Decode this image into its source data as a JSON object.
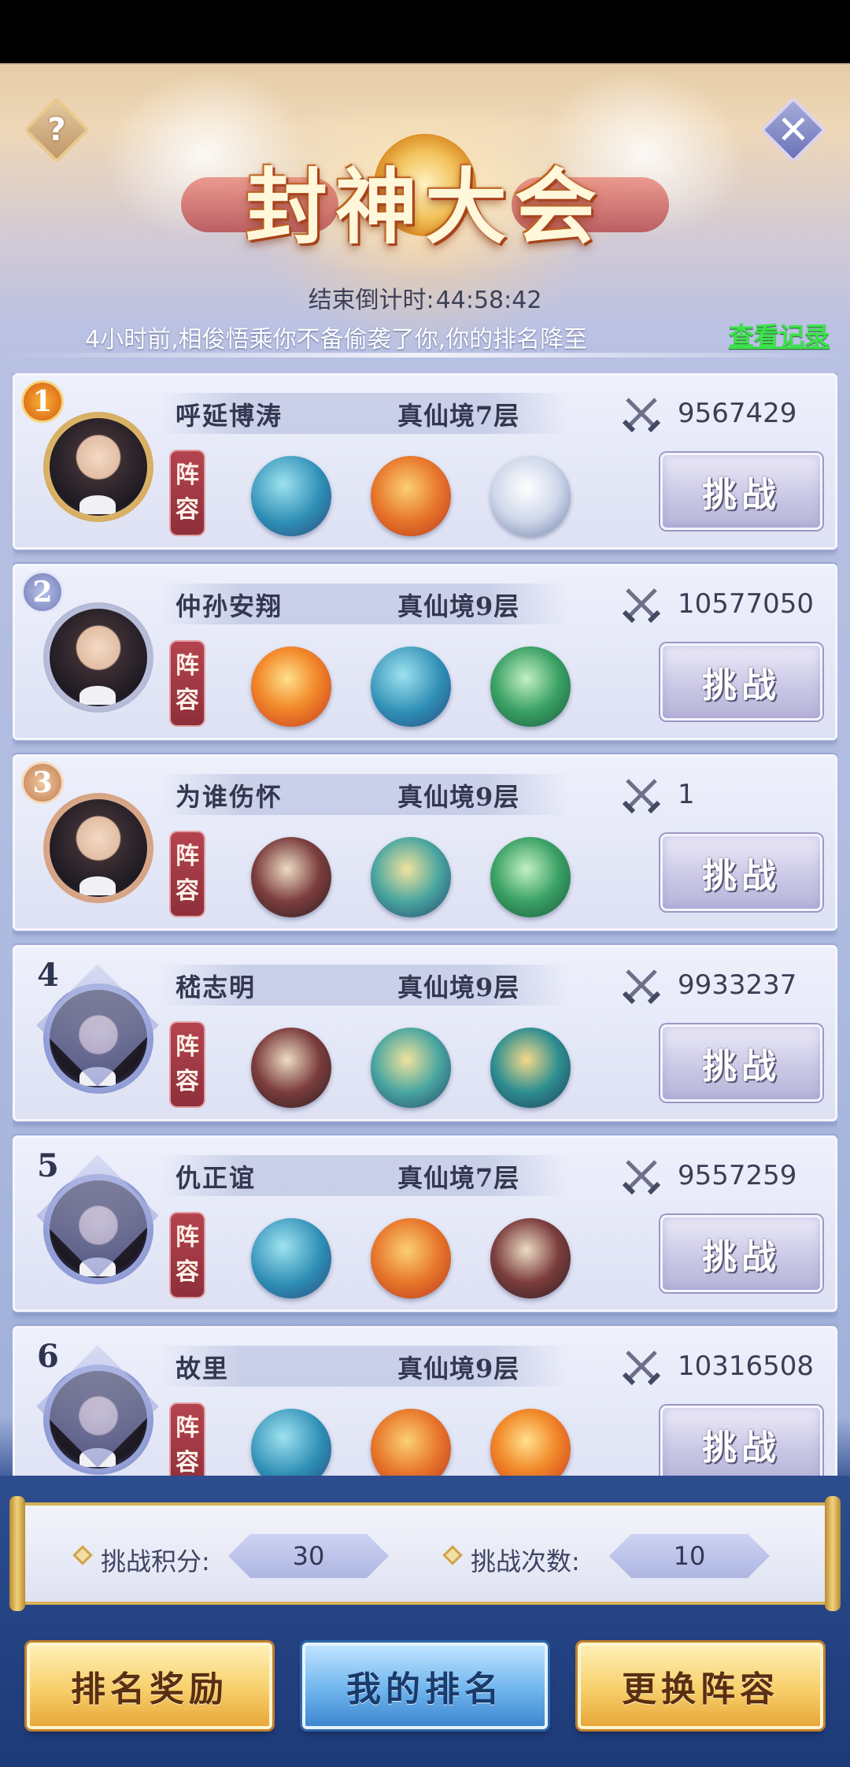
{
  "header": {
    "title": "封神大会",
    "help_glyph": "?",
    "close_glyph": "✕"
  },
  "countdown": {
    "label": "结束倒计时:",
    "value": "44:58:42"
  },
  "notice": {
    "text": "4小时前,相俊悟乘你不备偷袭了你,你的排名降至",
    "link_label": "查看记录"
  },
  "lineup_label_top": "阵",
  "lineup_label_bottom": "容",
  "challenge_label": "挑战",
  "players": [
    {
      "rank": "1",
      "name": "呼延博涛",
      "realm": "真仙境7层",
      "power": "9567429",
      "avatar": "male",
      "frame": "gold",
      "beasts": [
        "whale-icon",
        "red-dragon-icon",
        "white-tiger-icon"
      ]
    },
    {
      "rank": "2",
      "name": "仲孙安翔",
      "realm": "真仙境9层",
      "power": "10577050",
      "avatar": "male",
      "frame": "silver",
      "beasts": [
        "phoenix-icon",
        "whale-icon",
        "green-dragon-icon"
      ]
    },
    {
      "rank": "3",
      "name": "为谁伤怀",
      "realm": "真仙境9层",
      "power": "1",
      "avatar": "male",
      "frame": "bronze",
      "beasts": [
        "black-dragon-icon",
        "jade-dragon-icon",
        "green-dragon-icon"
      ]
    },
    {
      "rank": "4",
      "name": "嵇志明",
      "realm": "真仙境9层",
      "power": "9933237",
      "avatar": "female",
      "frame": "blue",
      "beasts": [
        "black-dragon-icon",
        "jade-dragon-icon",
        "teal-beast-icon"
      ]
    },
    {
      "rank": "5",
      "name": "仇正谊",
      "realm": "真仙境7层",
      "power": "9557259",
      "avatar": "female",
      "frame": "blue",
      "beasts": [
        "whale-icon",
        "red-dragon-icon",
        "black-dragon-icon"
      ]
    },
    {
      "rank": "6",
      "name": "故里",
      "realm": "真仙境9层",
      "power": "10316508",
      "avatar": "female",
      "frame": "blue",
      "beasts": [
        "whale-icon",
        "red-dragon-icon",
        "phoenix-icon"
      ]
    }
  ],
  "stats": {
    "score_label": "挑战积分:",
    "score_value": "30",
    "times_label": "挑战次数:",
    "times_value": "10"
  },
  "bottom_buttons": {
    "rewards": "排名奖励",
    "my_rank": "我的排名",
    "change_lineup": "更换阵容"
  }
}
